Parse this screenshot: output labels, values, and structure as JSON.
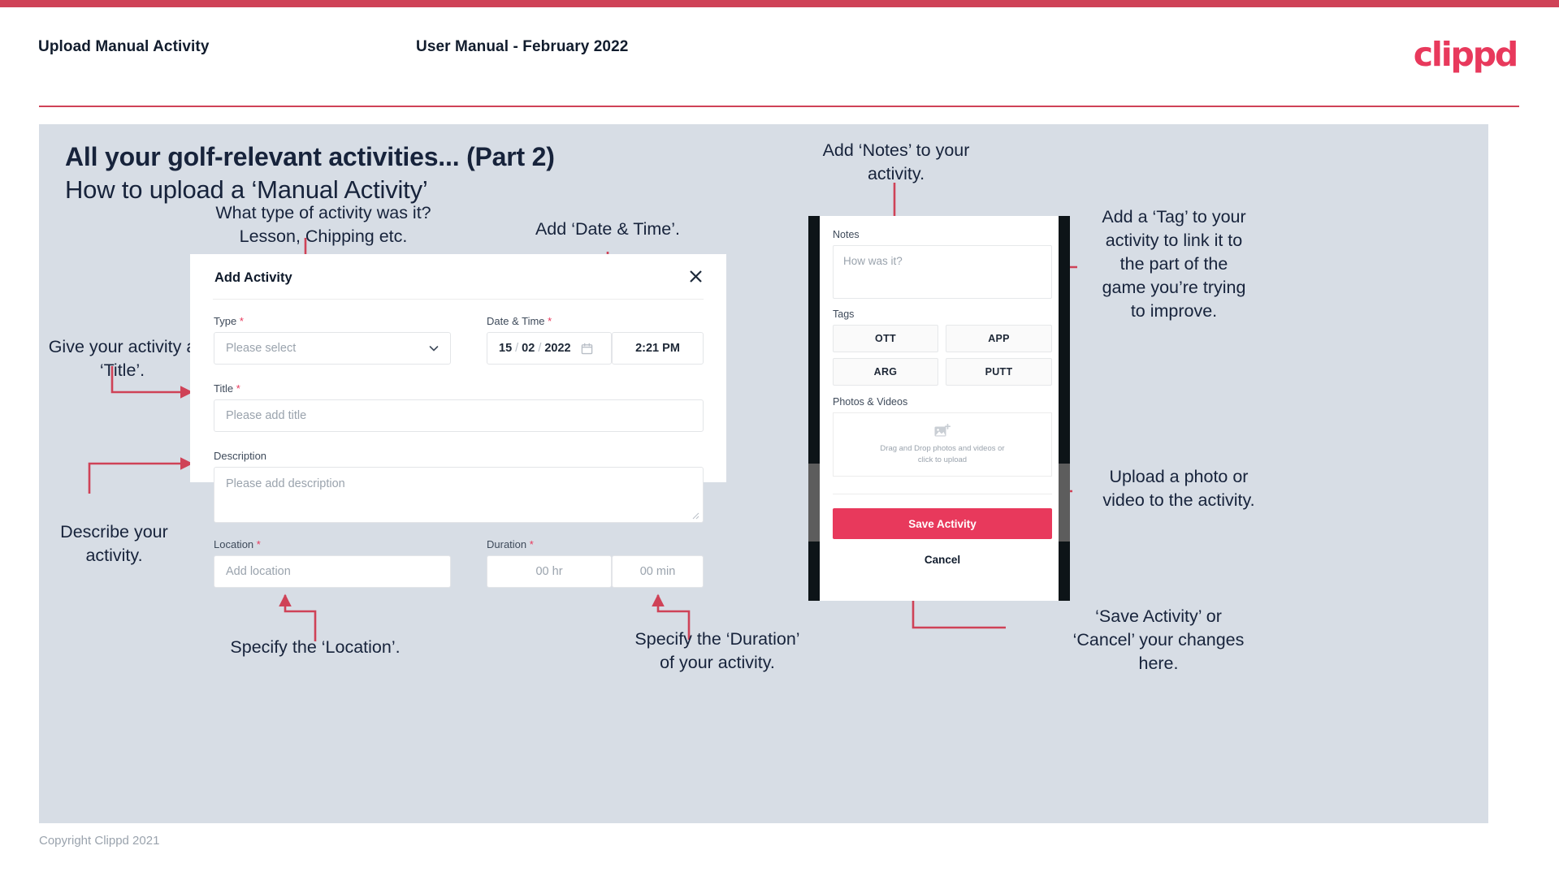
{
  "header": {
    "left_title": "Upload Manual Activity",
    "center_title": "User Manual - February 2022",
    "logo": "clippd"
  },
  "slide": {
    "title_main": "All your golf-relevant activities... (Part 2)",
    "title_sub": "How to upload a ‘Manual Activity’"
  },
  "annotations": {
    "type": "What type of activity was it?\nLesson, Chipping etc.",
    "type_line1": "What type of activity was it?",
    "type_line2": "Lesson, Chipping etc.",
    "datetime": "Add ‘Date & Time’.",
    "title_line1": "Give your activity a",
    "title_line2": "‘Title’.",
    "describe_line1": "Describe your",
    "describe_line2": "activity.",
    "location": "Specify the ‘Location’.",
    "duration_line1": "Specify the ‘Duration’",
    "duration_line2": "of your activity.",
    "notes_line1": "Add ‘Notes’ to your",
    "notes_line2": "activity.",
    "tag_line1": "Add a ‘Tag’ to your",
    "tag_line2": "activity to link it to",
    "tag_line3": "the part of the",
    "tag_line4": "game you’re trying",
    "tag_line5": "to improve.",
    "upload_line1": "Upload a photo or",
    "upload_line2": "video to the activity.",
    "save_line1": "‘Save Activity’ or",
    "save_line2": "‘Cancel’ your changes",
    "save_line3": "here."
  },
  "dialog": {
    "title": "Add Activity",
    "close_icon": "close-icon",
    "fields": {
      "type": {
        "label": "Type",
        "required": "*",
        "placeholder": "Please select",
        "chevron_icon": "chevron-down-icon"
      },
      "datetime": {
        "label": "Date & Time",
        "required": "*",
        "day": "15",
        "sep1": "/",
        "month": "02",
        "sep2": "/",
        "year": "2022",
        "calendar_icon": "calendar-icon",
        "time": "2:21 PM"
      },
      "title": {
        "label": "Title",
        "required": "*",
        "placeholder": "Please add title"
      },
      "description": {
        "label": "Description",
        "required": "",
        "placeholder": "Please add description"
      },
      "location": {
        "label": "Location",
        "required": "*",
        "placeholder": "Add location"
      },
      "duration": {
        "label": "Duration",
        "required": "*",
        "hours_placeholder": "00 hr",
        "minutes_placeholder": "00 min"
      }
    }
  },
  "phone": {
    "notes": {
      "label": "Notes",
      "placeholder": "How was it?"
    },
    "tags": {
      "label": "Tags",
      "items": [
        "OTT",
        "APP",
        "ARG",
        "PUTT"
      ]
    },
    "photos": {
      "label": "Photos & Videos",
      "icon": "add-image-icon",
      "drop_line1": "Drag and Drop photos and videos or",
      "drop_line2": "click to upload"
    },
    "save_label": "Save Activity",
    "cancel_label": "Cancel"
  },
  "footer": {
    "copyright": "Copyright Clippd 2021"
  },
  "colors": {
    "accent": "#e8395c",
    "bar": "#cf4257",
    "slide_bg": "#d7dde5",
    "text_dark": "#17233b",
    "connector": "#cf4257"
  }
}
